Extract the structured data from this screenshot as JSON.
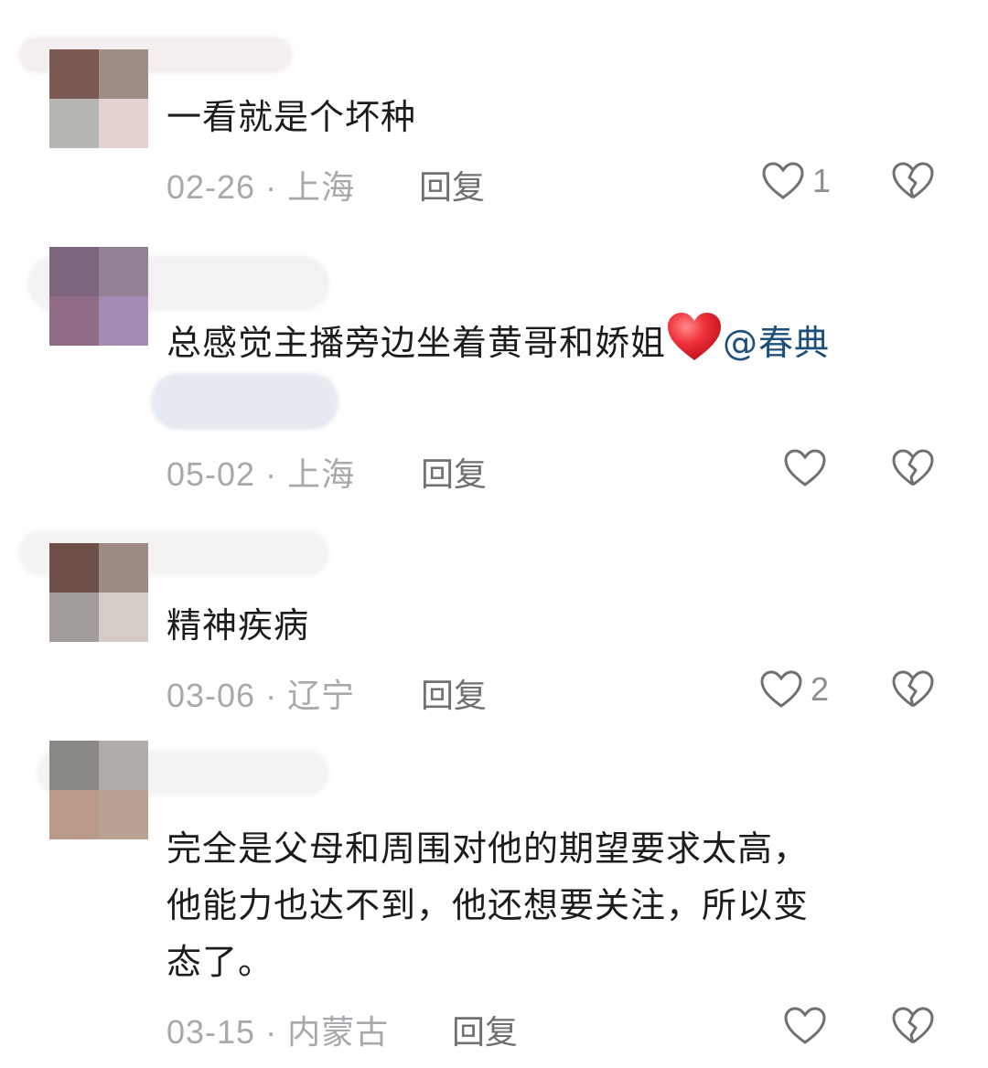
{
  "comments": [
    {
      "text": "一看就是个坏种",
      "date_location": "02-26 · 上海",
      "reply_label": "回复",
      "like_count": "1",
      "avatar_colors": [
        "#7a5a52",
        "#9e8e86",
        "#b8b6b2",
        "#e7d2d2"
      ]
    },
    {
      "text": "总感觉主播旁边坐着黄哥和娇姐",
      "mention": "@春典",
      "date_location": "05-02 · 上海",
      "reply_label": "回复",
      "like_count": "",
      "avatar_colors": [
        "#7c667e",
        "#938196",
        "#8f6b86",
        "#a48bb1"
      ]
    },
    {
      "text": "精神疾病",
      "date_location": "03-06 · 辽宁",
      "reply_label": "回复",
      "like_count": "2",
      "avatar_colors": [
        "#6e4f4a",
        "#9d8a82",
        "#a19c99",
        "#d6ccc7"
      ]
    },
    {
      "text_lines": [
        "完全是父母和周围对他的期望要求太高，",
        "他能力也达不到，他还想要关注，所以变",
        "态了。"
      ],
      "date_location": "03-15 · 内蒙古",
      "reply_label": "回复",
      "like_count": "",
      "avatar_colors": [
        "#8a8885",
        "#b2aca8",
        "#b9998a",
        "#b9a293"
      ]
    }
  ],
  "colors": {
    "text": "#1c1c1e",
    "meta": "#a8a8ad",
    "mention": "#1e4f7a",
    "icon_stroke": "#6f6f74"
  }
}
